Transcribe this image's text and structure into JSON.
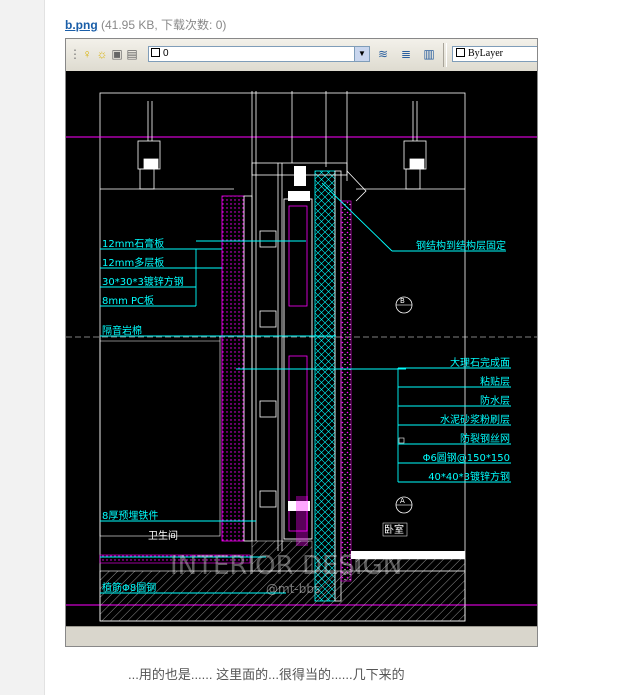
{
  "attachment": {
    "filename": "b.png",
    "meta": "(41.95 KB, 下载次数: 0)"
  },
  "cad": {
    "layer_value": "0",
    "linetype_value": "ByLayer",
    "colors": {
      "cyan": "#00ffff",
      "magenta": "#ff00ff",
      "yellow": "#ffff00",
      "white": "#ffffff",
      "red": "#ff0000"
    }
  },
  "drawing": {
    "labels_left": [
      "12mm石膏板",
      "12mm多层板",
      "30*30*3镀锌方钢",
      "8mm PC板",
      "隔音岩棉"
    ],
    "labels_right": [
      "大理石完成面",
      "粘贴层",
      "防水层",
      "水泥砂浆粉刷层",
      "防裂钢丝网",
      "Φ6圆钢@150*150",
      "40*40*3镀锌方钢"
    ],
    "top_note": "钢结构到结构层固定",
    "marker_b": "B",
    "marker_a": "A",
    "lower_left_1": "8厚预埋铁件",
    "lower_left_2": "卫生间",
    "lower_left_3": "植筋Φ8圆钢",
    "room_right": "卧室",
    "watermark_1": "INTERIOR DESIGN",
    "watermark_2": "@mt-bbs"
  },
  "caption": "...用的也是...... 这里面的...很得当的......几下来的"
}
